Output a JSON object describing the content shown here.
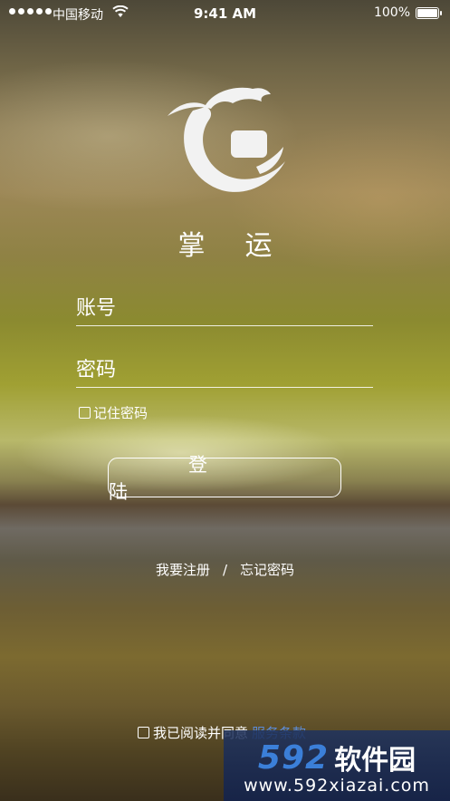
{
  "status_bar": {
    "carrier": "中国移动",
    "time": "9:41 AM",
    "battery_percent": "100%",
    "battery_level": 1.0
  },
  "app": {
    "name": "掌运",
    "name_chars": [
      "掌",
      "运"
    ],
    "logo_icon": "app-logo-icon"
  },
  "login_form": {
    "account_placeholder": "账号",
    "password_placeholder": "密码",
    "remember_label": "记住密码",
    "login_button": "登陆",
    "login_chars": [
      "登",
      "陆"
    ]
  },
  "links": {
    "register": "我要注册",
    "separator": "/",
    "forgot": "忘记密码"
  },
  "agreement": {
    "label": "我已阅读并同意",
    "terms": "服务条款"
  },
  "watermark": {
    "number": "592",
    "name": "软件园",
    "url": "www.592xiazai.com"
  },
  "colors": {
    "accent_link": "#5b8ad6",
    "watermark_number": "#3b7fd8"
  }
}
